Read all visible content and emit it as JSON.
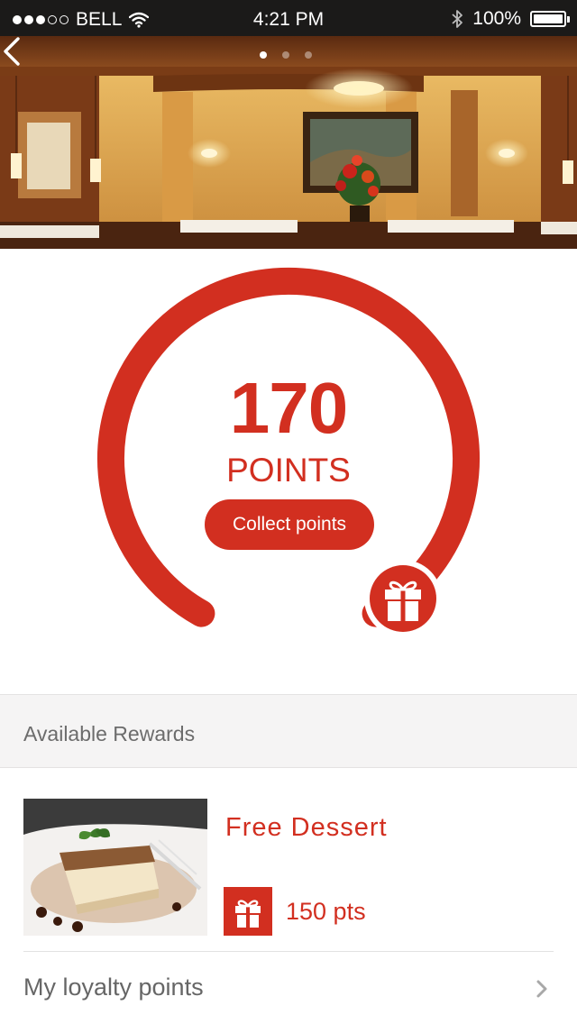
{
  "status_bar": {
    "carrier": "BELL",
    "time": "4:21 PM",
    "battery": "100%",
    "battery_level": 1.0,
    "signal_bars_filled": 3,
    "signal_bars_total": 5
  },
  "hero": {
    "back_icon": "chevron-left-icon",
    "pages_total": 3,
    "active_page": 1
  },
  "points": {
    "value": "170",
    "label": "POINTS",
    "collect_label": "Collect points",
    "gift_icon": "gift-icon"
  },
  "rewards_section": {
    "title": "Available Rewards"
  },
  "rewards": [
    {
      "title": "Free Dessert",
      "cost": "150 pts",
      "icon": "gift-icon"
    }
  ],
  "loyalty": {
    "label": "My loyalty points",
    "chevron_icon": "chevron-right-icon"
  },
  "colors": {
    "accent": "#d22f20",
    "status_bar_bg": "#1b1a19",
    "section_bg": "#f5f4f4",
    "muted_text": "#6c6c6c"
  }
}
